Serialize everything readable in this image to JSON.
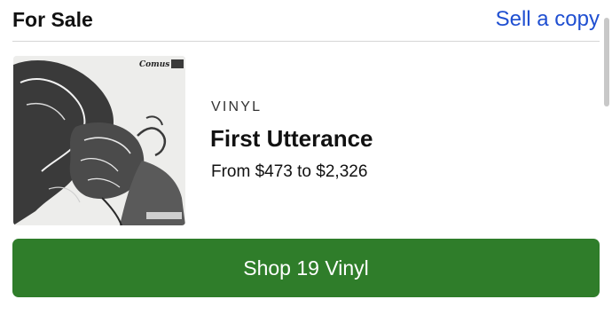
{
  "header": {
    "title": "For Sale",
    "sell_link": "Sell a copy"
  },
  "listing": {
    "cover_alt": "Comus – First Utterance cover art",
    "cover_logo_text": "Comus",
    "format": "VINYL",
    "title": "First Utterance",
    "price_range": "From $473 to $2,326"
  },
  "shop_button": {
    "label": "Shop 19 Vinyl"
  },
  "colors": {
    "accent_link": "#1f4fd1",
    "button_green": "#2f7d2a"
  }
}
